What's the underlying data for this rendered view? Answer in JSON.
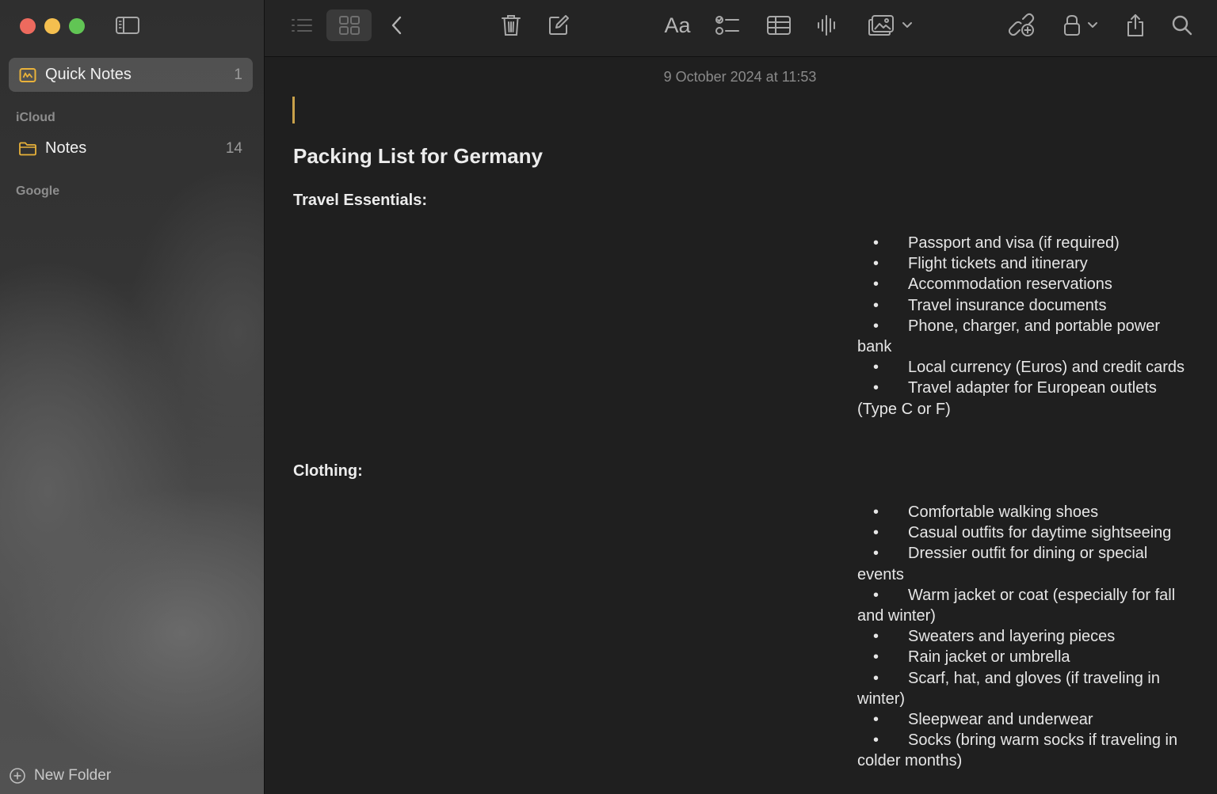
{
  "sidebar": {
    "quick_notes": {
      "label": "Quick Notes",
      "count": "1"
    },
    "sections": [
      {
        "title": "iCloud",
        "items": [
          {
            "label": "Notes",
            "count": "14"
          }
        ]
      },
      {
        "title": "Google",
        "items": []
      }
    ],
    "new_folder_label": "New Folder"
  },
  "toolbar": {
    "icons": [
      "list-view-icon",
      "gallery-view-icon",
      "back-icon",
      "trash-icon",
      "compose-icon",
      "format-icon",
      "checklist-icon",
      "table-icon",
      "audio-icon",
      "media-icon",
      "collaborate-icon",
      "lock-icon",
      "share-icon",
      "search-icon"
    ],
    "format_label": "Aa"
  },
  "note": {
    "timestamp": "9 October 2024 at 11:53",
    "title": "Packing List for Germany",
    "sections": [
      {
        "heading": "Travel Essentials:",
        "items": [
          "Passport and visa (if required)",
          "Flight tickets and itinerary",
          "Accommodation reservations",
          "Travel insurance documents",
          "Phone, charger, and portable power bank",
          "Local currency (Euros) and credit cards",
          "Travel adapter for European outlets (Type C or F)"
        ]
      },
      {
        "heading": "Clothing:",
        "items": [
          "Comfortable walking shoes",
          "Casual outfits for daytime sightseeing",
          "Dressier outfit for dining or special events",
          "Warm jacket or coat (especially for fall and winter)",
          "Sweaters and layering pieces",
          "Rain jacket or umbrella",
          "Scarf, hat, and gloves (if traveling in winter)",
          "Sleepwear and underwear",
          "Socks (bring warm socks if traveling in colder months)"
        ]
      }
    ],
    "bullet": "•"
  },
  "colors": {
    "accent": "#e9b23a",
    "caret": "#c8a14a",
    "close": "#ed6a5e",
    "minimize": "#f5bf4f",
    "maximize": "#61c554"
  }
}
